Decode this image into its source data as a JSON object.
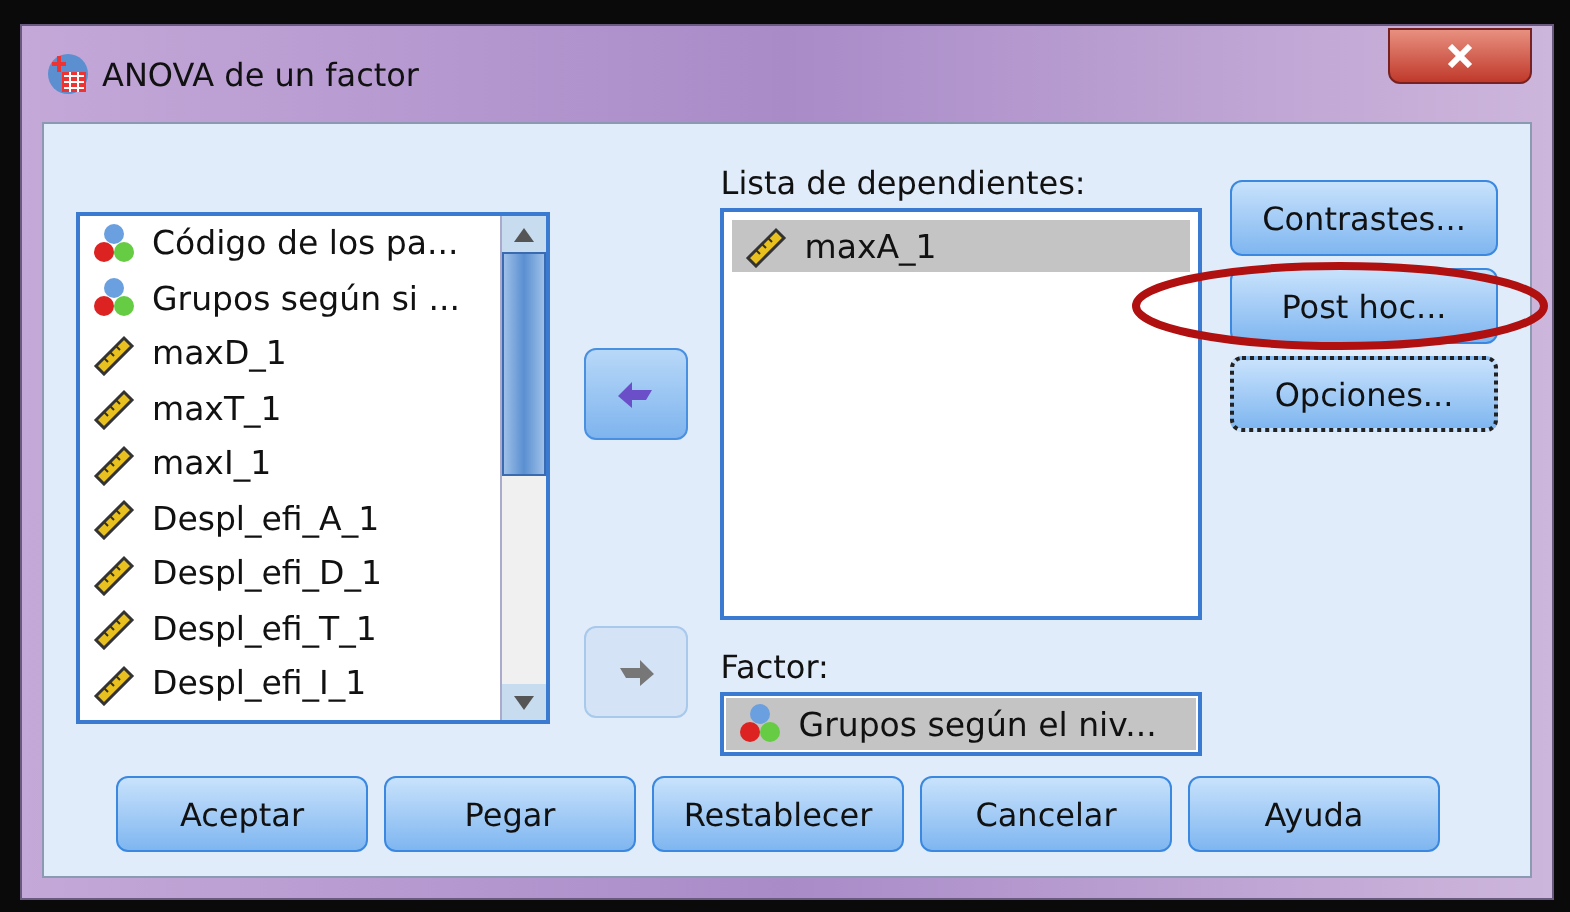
{
  "window": {
    "title": "ANOVA de un factor"
  },
  "variables": [
    {
      "label": "Código de los pa...",
      "kind": "nominal"
    },
    {
      "label": "Grupos según si ...",
      "kind": "nominal"
    },
    {
      "label": "maxD_1",
      "kind": "scale"
    },
    {
      "label": "maxT_1",
      "kind": "scale"
    },
    {
      "label": "maxI_1",
      "kind": "scale"
    },
    {
      "label": "Despl_efi_A_1",
      "kind": "scale"
    },
    {
      "label": "Despl_efi_D_1",
      "kind": "scale"
    },
    {
      "label": "Despl_efi_T_1",
      "kind": "scale"
    },
    {
      "label": "Despl_efi_I_1",
      "kind": "scale"
    }
  ],
  "move_buttons": [
    {
      "disabled": false
    },
    {
      "disabled": true
    }
  ],
  "dependents": {
    "label": "Lista de dependientes:",
    "items": [
      {
        "label": "maxA_1",
        "kind": "scale",
        "selected": true
      }
    ]
  },
  "factor": {
    "label": "Factor:",
    "item": {
      "label": "Grupos según el niv...",
      "kind": "nominal",
      "selected": true
    }
  },
  "side_buttons": [
    {
      "label": "Contrastes...",
      "focused": false,
      "highlighted": false
    },
    {
      "label": "Post hoc...",
      "focused": false,
      "highlighted": true
    },
    {
      "label": "Opciones...",
      "focused": true,
      "highlighted": false
    }
  ],
  "buttons": [
    "Aceptar",
    "Pegar",
    "Restablecer",
    "Cancelar",
    "Ayuda"
  ]
}
